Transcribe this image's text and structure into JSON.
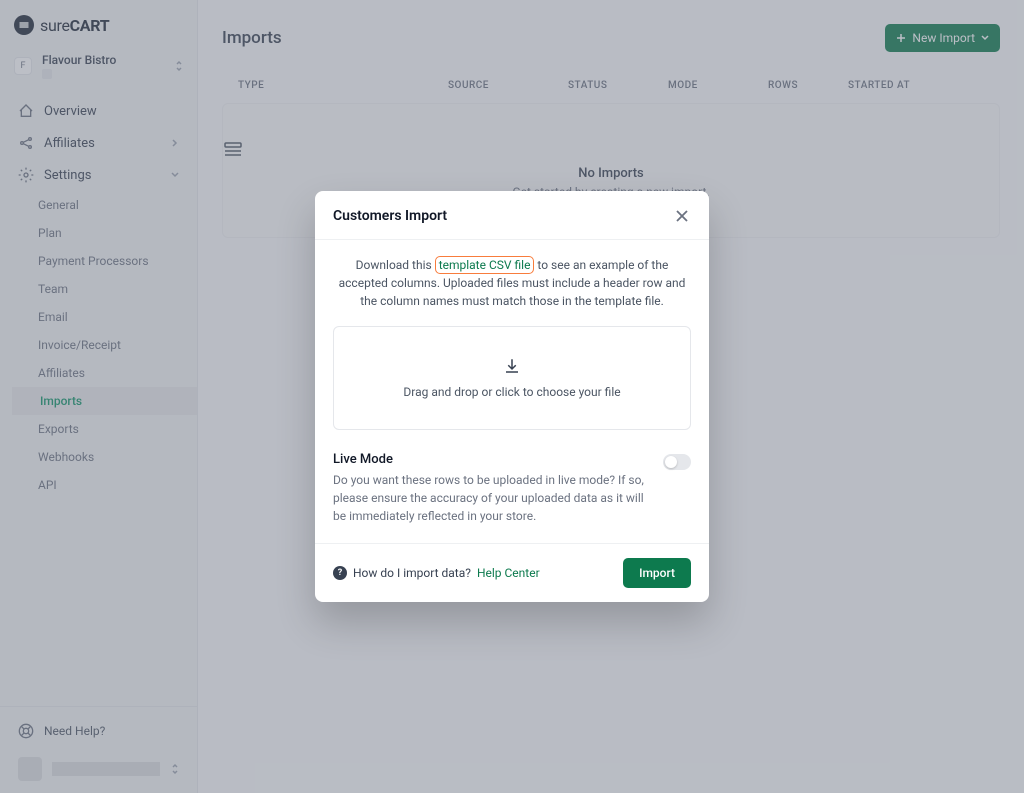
{
  "brand": {
    "logo_prefix": "sure",
    "logo_suffix": "CART"
  },
  "workspace": {
    "badge": "F",
    "name": "Flavour Bistro"
  },
  "nav": {
    "overview": "Overview",
    "affiliates": "Affiliates",
    "settings": "Settings",
    "sub": {
      "general": "General",
      "plan": "Plan",
      "payment_processors": "Payment Processors",
      "team": "Team",
      "email": "Email",
      "invoice_receipt": "Invoice/Receipt",
      "affiliates": "Affiliates",
      "imports": "Imports",
      "exports": "Exports",
      "webhooks": "Webhooks",
      "api": "API"
    },
    "need_help": "Need Help?"
  },
  "page": {
    "title": "Imports",
    "new_import_btn": "New Import",
    "columns": {
      "type": "TYPE",
      "source": "SOURCE",
      "status": "STATUS",
      "mode": "MODE",
      "rows": "ROWS",
      "started_at": "STARTED AT"
    },
    "empty": {
      "title": "No Imports",
      "subtitle": "Get started by creating a new import."
    }
  },
  "modal": {
    "title": "Customers Import",
    "desc_part1": "Download this ",
    "desc_link": "template CSV file",
    "desc_part2": " to see an example of the accepted columns. Uploaded files must include a header row and the column names must match those in the template file.",
    "dropzone": "Drag and drop or click to choose your file",
    "live_mode": {
      "title": "Live Mode",
      "desc": "Do you want these rows to be uploaded in live mode? If so, please ensure the accuracy of your uploaded data as it will be immediately reflected in your store."
    },
    "footer": {
      "help_q": "How do I import data?",
      "help_link": "Help Center",
      "import_btn": "Import"
    }
  }
}
